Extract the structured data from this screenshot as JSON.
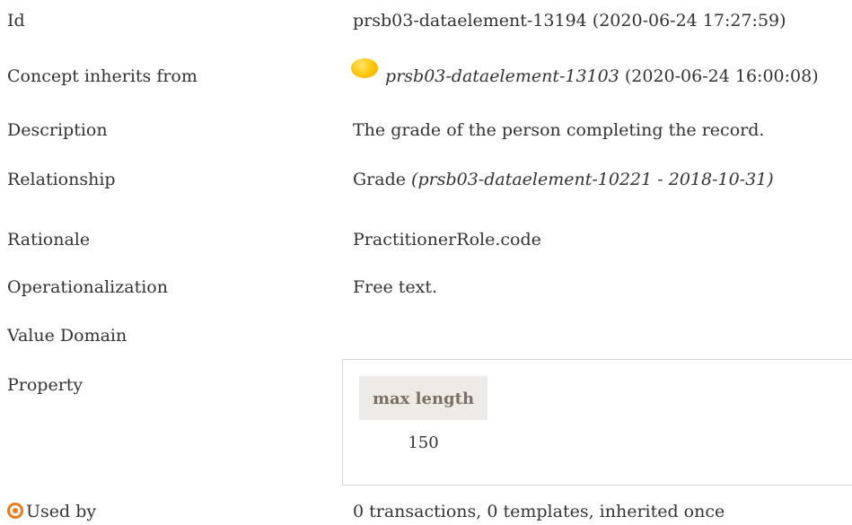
{
  "rows": {
    "id": {
      "label": "Id",
      "value": "prsb03-dataelement-13194 (2020-06-24 17:27:59)"
    },
    "inherits": {
      "label": "Concept inherits from",
      "link": "prsb03-dataelement-13103",
      "suffix": "(2020-06-24 16:00:08)"
    },
    "description": {
      "label": "Description",
      "value": "The grade of the person completing the record."
    },
    "relationship": {
      "label": "Relationship",
      "value": "Grade",
      "ref": "(prsb03-dataelement-10221 - 2018-10-31)"
    },
    "rationale": {
      "label": "Rationale",
      "value": "PractitionerRole.code"
    },
    "operationalization": {
      "label": "Operationalization",
      "value": "Free text."
    },
    "value_domain": {
      "label": "Value Domain"
    },
    "property": {
      "label": "Property",
      "header": "max length",
      "value": "150"
    },
    "used_by": {
      "label": "Used by",
      "value": "0 transactions, 0 templates, inherited once"
    }
  },
  "icons": {
    "inherit_bullet": "yellow-ball-icon",
    "used_by": "target-icon"
  },
  "colors": {
    "accent": "#f07a1a",
    "header_bg": "#eeebe7",
    "header_text": "#7a6f63"
  }
}
